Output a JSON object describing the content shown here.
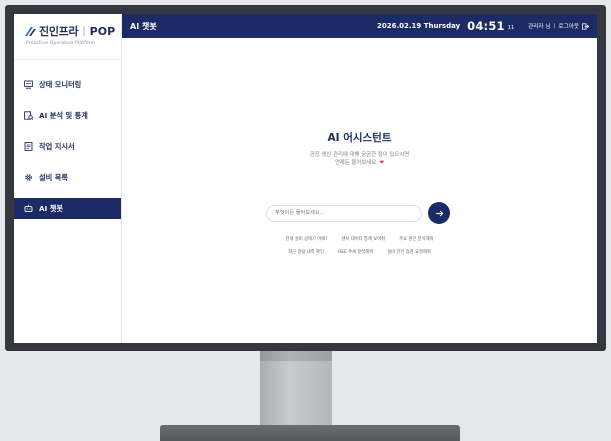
{
  "brand": {
    "name": "진인프라",
    "separator": "|",
    "product": "POP",
    "subtitle": "Proactive Operation Platform"
  },
  "sidebar": {
    "items": [
      {
        "label": "상태 모니터링",
        "icon": "monitor-icon",
        "active": false
      },
      {
        "label": "AI 분석 및 통계",
        "icon": "analytics-icon",
        "active": false
      },
      {
        "label": "작업 지시서",
        "icon": "document-icon",
        "active": false
      },
      {
        "label": "설비 목록",
        "icon": "gear-icon",
        "active": false
      },
      {
        "label": "AI 챗봇",
        "icon": "chatbot-icon",
        "active": true
      }
    ]
  },
  "header": {
    "title": "AI 챗봇",
    "date": "2026.02.19 Thursday",
    "time": "04:51",
    "seconds": "11",
    "user": "관리자 님",
    "divider": "|",
    "logout": "로그아웃"
  },
  "chat": {
    "title": "AI 어시스턴트",
    "desc_line1": "공장 생산 관리에 대해 궁금한 점이 있으시면",
    "desc_line2": "언제든 물어보세요.",
    "heart": "❤",
    "input_placeholder": "무엇이든 물어보세요...",
    "suggestions_row1": [
      "현재 설비 상태가 어때?",
      "센서 데이터 통계 보여줘",
      "주요 원인 분석해줘"
    ],
    "suggestions_row2": [
      "최근 알람 내역 확인",
      "OEE 추세 분석해줘",
      "설비 안전 점검 요령해줘"
    ]
  },
  "colors": {
    "navy": "#1c2a66",
    "heart": "#e0344b"
  }
}
